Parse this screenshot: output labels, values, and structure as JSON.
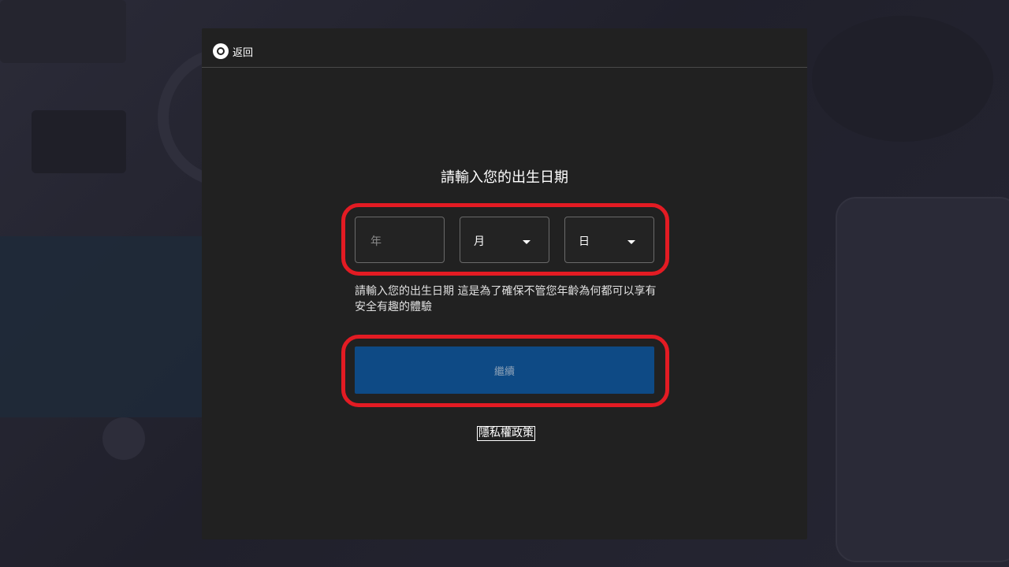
{
  "header": {
    "back_label": "返回",
    "back_icon": "back-circle-icon"
  },
  "form": {
    "title": "請輸入您的出生日期",
    "year_placeholder": "年",
    "month_value": "月",
    "day_value": "日",
    "description": "請輸入您的出生日期 這是為了確保不管您年齡為何都可以享有安全有趣的體驗",
    "continue_label": "繼續",
    "privacy_label": "隱私權政策"
  },
  "colors": {
    "highlight": "#e31b23",
    "button": "#0e4a85",
    "dialog": "#212121"
  }
}
